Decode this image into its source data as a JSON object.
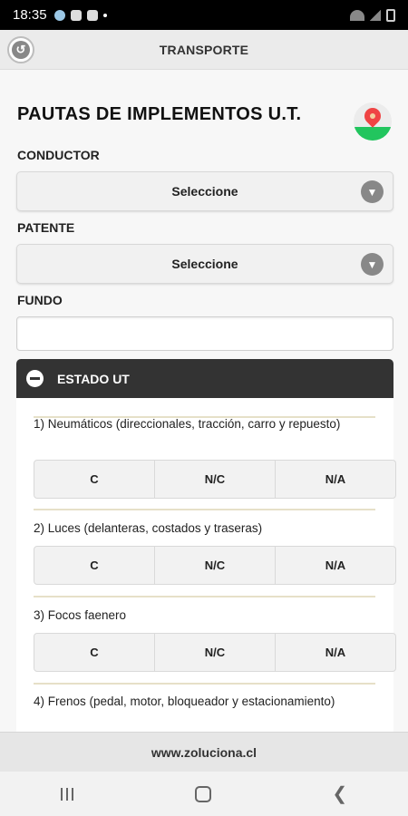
{
  "status_bar": {
    "time": "18:35"
  },
  "app_bar": {
    "title": "TRANSPORTE"
  },
  "page": {
    "title": "PAUTAS DE IMPLEMENTOS U.T."
  },
  "conductor": {
    "label": "CONDUCTOR",
    "value": "Seleccione"
  },
  "patente": {
    "label": "PATENTE",
    "value": "Seleccione"
  },
  "fundo": {
    "label": "FUNDO",
    "value": ""
  },
  "section": {
    "title": "ESTADO UT"
  },
  "questions": [
    {
      "text": "1) Neumáticos (direccionales, tracción, carro y repuesto)",
      "options": [
        "C",
        "N/C",
        "N/A"
      ]
    },
    {
      "text": "2) Luces (delanteras, costados y traseras)",
      "options": [
        "C",
        "N/C",
        "N/A"
      ]
    },
    {
      "text": "3) Focos faenero",
      "options": [
        "C",
        "N/C",
        "N/A"
      ]
    },
    {
      "text": "4) Frenos (pedal, motor, bloqueador y estacionamiento)",
      "options": []
    }
  ],
  "footer": {
    "text": "www.zoluciona.cl"
  },
  "colors": {
    "section_header_bg": "#333333",
    "logo_pin": "#ef4444",
    "logo_ground": "#22c55e"
  }
}
